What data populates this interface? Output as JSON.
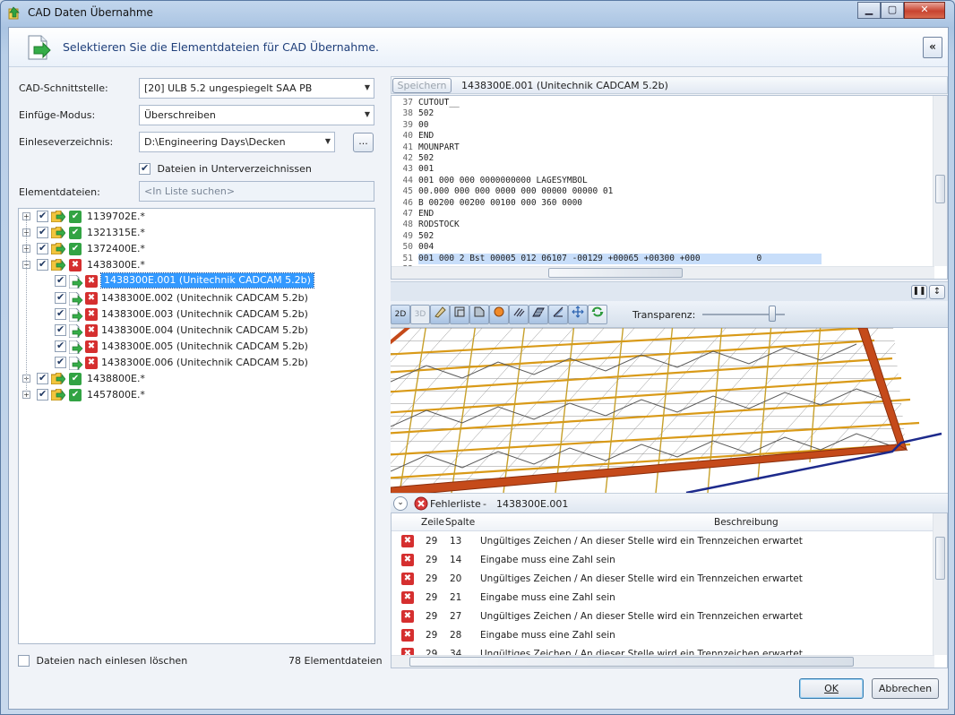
{
  "window": {
    "title": "CAD Daten Übernahme"
  },
  "header": {
    "text": "Selektieren Sie die Elementdateien für CAD Übernahme.",
    "collapse_label": "«"
  },
  "form": {
    "interface_label": "CAD-Schnittstelle:",
    "interface_value": "[20] ULB 5.2 ungespiegelt SAA PB",
    "mode_label": "Einfüge-Modus:",
    "mode_value": "Überschreiben",
    "dir_label": "Einleseverzeichnis:",
    "dir_value": "D:\\Engineering Days\\Decken",
    "browse_label": "...",
    "subdirs_label": "Dateien in Unterverzeichnissen",
    "files_label": "Elementdateien:",
    "search_placeholder": "<In Liste suchen>"
  },
  "tree": [
    {
      "label": "1139702E.*",
      "status": "ok",
      "level": 0,
      "expander": "+"
    },
    {
      "label": "1321315E.*",
      "status": "ok",
      "level": 0,
      "expander": "+"
    },
    {
      "label": "1372400E.*",
      "status": "ok",
      "level": 0,
      "expander": "+"
    },
    {
      "label": "1438300E.*",
      "status": "error",
      "level": 0,
      "expander": "−"
    },
    {
      "label": "1438300E.001  (Unitechnik CADCAM 5.2b)",
      "status": "error",
      "level": 1,
      "selected": true
    },
    {
      "label": "1438300E.002  (Unitechnik CADCAM 5.2b)",
      "status": "error",
      "level": 1
    },
    {
      "label": "1438300E.003  (Unitechnik CADCAM 5.2b)",
      "status": "error",
      "level": 1
    },
    {
      "label": "1438300E.004  (Unitechnik CADCAM 5.2b)",
      "status": "error",
      "level": 1
    },
    {
      "label": "1438300E.005  (Unitechnik CADCAM 5.2b)",
      "status": "error",
      "level": 1
    },
    {
      "label": "1438300E.006  (Unitechnik CADCAM 5.2b)",
      "status": "error",
      "level": 1
    },
    {
      "label": "1438800E.*",
      "status": "ok",
      "level": 0,
      "expander": "+"
    },
    {
      "label": "1457800E.*",
      "status": "ok",
      "level": 0,
      "expander": "+"
    }
  ],
  "footer_left": {
    "delete_label": "Dateien nach einlesen löschen",
    "count_label": "78 Elementdateien"
  },
  "editor": {
    "save_label": "Speichern",
    "file_title": "1438300E.001 (Unitechnik CADCAM 5.2b)",
    "lines": [
      {
        "n": "37",
        "t": "CUTOUT__"
      },
      {
        "n": "38",
        "t": "502"
      },
      {
        "n": "39",
        "t": "00"
      },
      {
        "n": "40",
        "t": "END"
      },
      {
        "n": "41",
        "t": "MOUNPART"
      },
      {
        "n": "42",
        "t": "502"
      },
      {
        "n": "43",
        "t": "001"
      },
      {
        "n": "44",
        "t": "001 000 000 0000000000 LAGESYMBOL"
      },
      {
        "n": "45",
        "t": "00.000 000 000 0000 000 00000 00000 01"
      },
      {
        "n": "46",
        "t": "B 00200 00200 00100 000 360 0000"
      },
      {
        "n": "47",
        "t": "END"
      },
      {
        "n": "48",
        "t": "RODSTOCK"
      },
      {
        "n": "49",
        "t": "502"
      },
      {
        "n": "50",
        "t": "004"
      },
      {
        "n": "51",
        "t": "001 000 2 Bst 00005 012 06107 -00129 +00065 +00300 +000           0",
        "highlight": true
      },
      {
        "n": "52",
        "t": ""
      }
    ]
  },
  "viewer": {
    "btn_2d": "2D",
    "btn_3d": "3D",
    "transparency_label": "Transparenz:",
    "transparency_value": 0.85
  },
  "errors": {
    "title": "Fehlerliste",
    "separator": "-",
    "file": "1438300E.001",
    "columns": {
      "line": "Zeile",
      "col": "Spalte",
      "desc": "Beschreibung"
    },
    "rows": [
      {
        "line": "29",
        "col": "13",
        "desc": "Ungültiges Zeichen / An dieser Stelle wird ein Trennzeichen erwartet"
      },
      {
        "line": "29",
        "col": "14",
        "desc": "Eingabe muss eine Zahl sein"
      },
      {
        "line": "29",
        "col": "20",
        "desc": "Ungültiges Zeichen / An dieser Stelle wird ein Trennzeichen erwartet"
      },
      {
        "line": "29",
        "col": "21",
        "desc": "Eingabe muss eine Zahl sein"
      },
      {
        "line": "29",
        "col": "27",
        "desc": "Ungültiges Zeichen / An dieser Stelle wird ein Trennzeichen erwartet"
      },
      {
        "line": "29",
        "col": "28",
        "desc": "Eingabe muss eine Zahl sein"
      },
      {
        "line": "29",
        "col": "34",
        "desc": "Ungültiges Zeichen / An dieser Stelle wird ein Trennzeichen erwartet"
      }
    ]
  },
  "buttons": {
    "ok": "OK",
    "cancel": "Abbrechen"
  },
  "colors": {
    "accent": "#3399ff",
    "ok": "#32a343",
    "error": "#d52f2f",
    "header_text": "#1f3f7a"
  }
}
